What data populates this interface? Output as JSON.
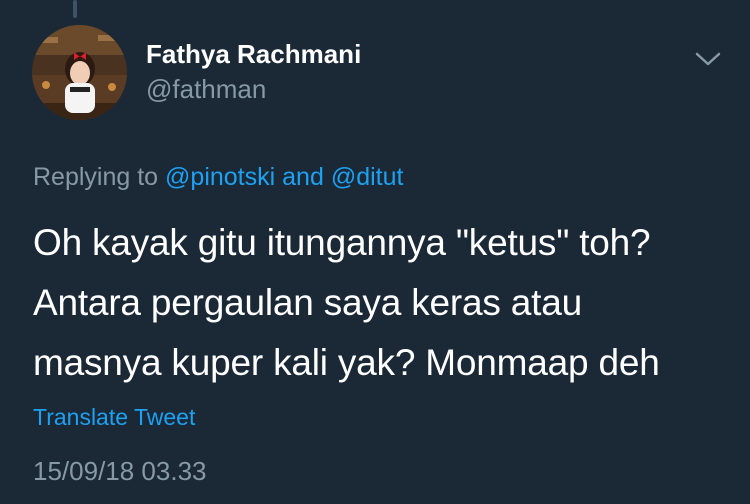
{
  "tweet": {
    "author": {
      "display_name": "Fathya Rachmani",
      "handle": "@fathman"
    },
    "replying": {
      "prefix": "Replying to",
      "mention_1": "@pinotski",
      "conjunction": "and",
      "mention_2": "@ditut"
    },
    "text_lines": [
      "Oh kayak gitu itungannya \"ketus\" toh?",
      "Antara pergaulan saya keras atau",
      "masnya kuper kali yak? Monmaap deh"
    ],
    "translate_label": "Translate Tweet",
    "timestamp": "15/09/18 03.33"
  },
  "icons": {
    "menu": "chevron-down-icon"
  },
  "colors": {
    "background": "#1b2836",
    "primary_text": "#ffffff",
    "secondary_text": "#8899a6",
    "link": "#1da1f2"
  }
}
